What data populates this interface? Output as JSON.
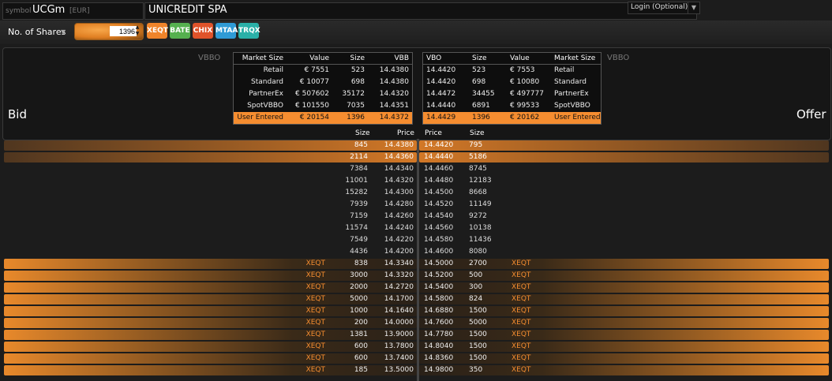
{
  "header": {
    "symbol_label": "symbol",
    "symbol": "UCGm",
    "currency": "[EUR]",
    "company": "UNICREDIT SPA",
    "login": "Login (Optional)"
  },
  "toolbar": {
    "shares_label": "No. of Shares",
    "quantity": "1396",
    "venues": [
      {
        "label": "XEQT",
        "color": "#f0842a"
      },
      {
        "label": "BATE",
        "color": "#55b04f"
      },
      {
        "label": "CHIX",
        "color": "#e0532a"
      },
      {
        "label": "MTAA",
        "color": "#2f9bd6"
      },
      {
        "label": "TRQX",
        "color": "#2ab0a8"
      }
    ]
  },
  "panel": {
    "bid_label": "Bid",
    "offer_label": "Offer",
    "vbbo_label": "VBBO"
  },
  "vbb_table": {
    "headers": [
      "Market Size",
      "Value",
      "Size",
      "VBB"
    ],
    "rows": [
      [
        "Retail",
        "€ 7551",
        "523",
        "14.4380"
      ],
      [
        "Standard",
        "€ 10077",
        "698",
        "14.4380"
      ],
      [
        "PartnerEx",
        "€ 507602",
        "35172",
        "14.4320"
      ],
      [
        "SpotVBBO",
        "€ 101550",
        "7035",
        "14.4351"
      ],
      [
        "User Entered",
        "€ 20154",
        "1396",
        "14.4372"
      ]
    ]
  },
  "vbo_table": {
    "headers": [
      "VBO",
      "Size",
      "Value",
      "Market Size"
    ],
    "rows": [
      [
        "14.4420",
        "523",
        "€ 7553",
        "Retail"
      ],
      [
        "14.4420",
        "698",
        "€ 10080",
        "Standard"
      ],
      [
        "14.4472",
        "34455",
        "€ 497777",
        "PartnerEx"
      ],
      [
        "14.4440",
        "6891",
        "€ 99533",
        "SpotVBBO"
      ],
      [
        "14.4429",
        "1396",
        "€ 20162",
        "User Entered"
      ]
    ]
  },
  "depth": {
    "bid_headers": [
      "Size",
      "Price"
    ],
    "ask_headers": [
      "Price",
      "Size"
    ],
    "rows": [
      {
        "bid_size": "845",
        "bid_price": "14.4380",
        "ask_price": "14.4420",
        "ask_size": "795",
        "style": "top"
      },
      {
        "bid_size": "2114",
        "bid_price": "14.4360",
        "ask_price": "14.4440",
        "ask_size": "5186",
        "style": "top"
      },
      {
        "bid_size": "7384",
        "bid_price": "14.4340",
        "ask_price": "14.4460",
        "ask_size": "8745",
        "style": "plain"
      },
      {
        "bid_size": "11001",
        "bid_price": "14.4320",
        "ask_price": "14.4480",
        "ask_size": "12183",
        "style": "plain"
      },
      {
        "bid_size": "15282",
        "bid_price": "14.4300",
        "ask_price": "14.4500",
        "ask_size": "8668",
        "style": "plain"
      },
      {
        "bid_size": "7939",
        "bid_price": "14.4280",
        "ask_price": "14.4520",
        "ask_size": "11149",
        "style": "plain"
      },
      {
        "bid_size": "7159",
        "bid_price": "14.4260",
        "ask_price": "14.4540",
        "ask_size": "9272",
        "style": "plain"
      },
      {
        "bid_size": "11574",
        "bid_price": "14.4240",
        "ask_price": "14.4560",
        "ask_size": "10138",
        "style": "plain"
      },
      {
        "bid_size": "7549",
        "bid_price": "14.4220",
        "ask_price": "14.4580",
        "ask_size": "11436",
        "style": "plain"
      },
      {
        "bid_size": "4436",
        "bid_price": "14.4200",
        "ask_price": "14.4600",
        "ask_size": "8080",
        "style": "plain"
      }
    ]
  },
  "venue_orders": {
    "rows": [
      {
        "bid_venue": "XEQT",
        "bid_size": "838",
        "bid_price": "14.3340",
        "ask_price": "14.5000",
        "ask_size": "2700",
        "ask_venue": "XEQT"
      },
      {
        "bid_venue": "XEQT",
        "bid_size": "3000",
        "bid_price": "14.3320",
        "ask_price": "14.5200",
        "ask_size": "500",
        "ask_venue": "XEQT"
      },
      {
        "bid_venue": "XEQT",
        "bid_size": "2000",
        "bid_price": "14.2720",
        "ask_price": "14.5400",
        "ask_size": "300",
        "ask_venue": "XEQT"
      },
      {
        "bid_venue": "XEQT",
        "bid_size": "5000",
        "bid_price": "14.1700",
        "ask_price": "14.5800",
        "ask_size": "824",
        "ask_venue": "XEQT"
      },
      {
        "bid_venue": "XEQT",
        "bid_size": "1000",
        "bid_price": "14.1640",
        "ask_price": "14.6880",
        "ask_size": "1500",
        "ask_venue": "XEQT"
      },
      {
        "bid_venue": "XEQT",
        "bid_size": "200",
        "bid_price": "14.0000",
        "ask_price": "14.7600",
        "ask_size": "5000",
        "ask_venue": "XEQT"
      },
      {
        "bid_venue": "XEQT",
        "bid_size": "1381",
        "bid_price": "13.9000",
        "ask_price": "14.7780",
        "ask_size": "1500",
        "ask_venue": "XEQT"
      },
      {
        "bid_venue": "XEQT",
        "bid_size": "600",
        "bid_price": "13.7800",
        "ask_price": "14.8040",
        "ask_size": "1500",
        "ask_venue": "XEQT"
      },
      {
        "bid_venue": "XEQT",
        "bid_size": "600",
        "bid_price": "13.7400",
        "ask_price": "14.8360",
        "ask_size": "1500",
        "ask_venue": "XEQT"
      },
      {
        "bid_venue": "XEQT",
        "bid_size": "185",
        "bid_price": "13.5000",
        "ask_price": "14.9800",
        "ask_size": "350",
        "ask_venue": "XEQT"
      }
    ]
  }
}
